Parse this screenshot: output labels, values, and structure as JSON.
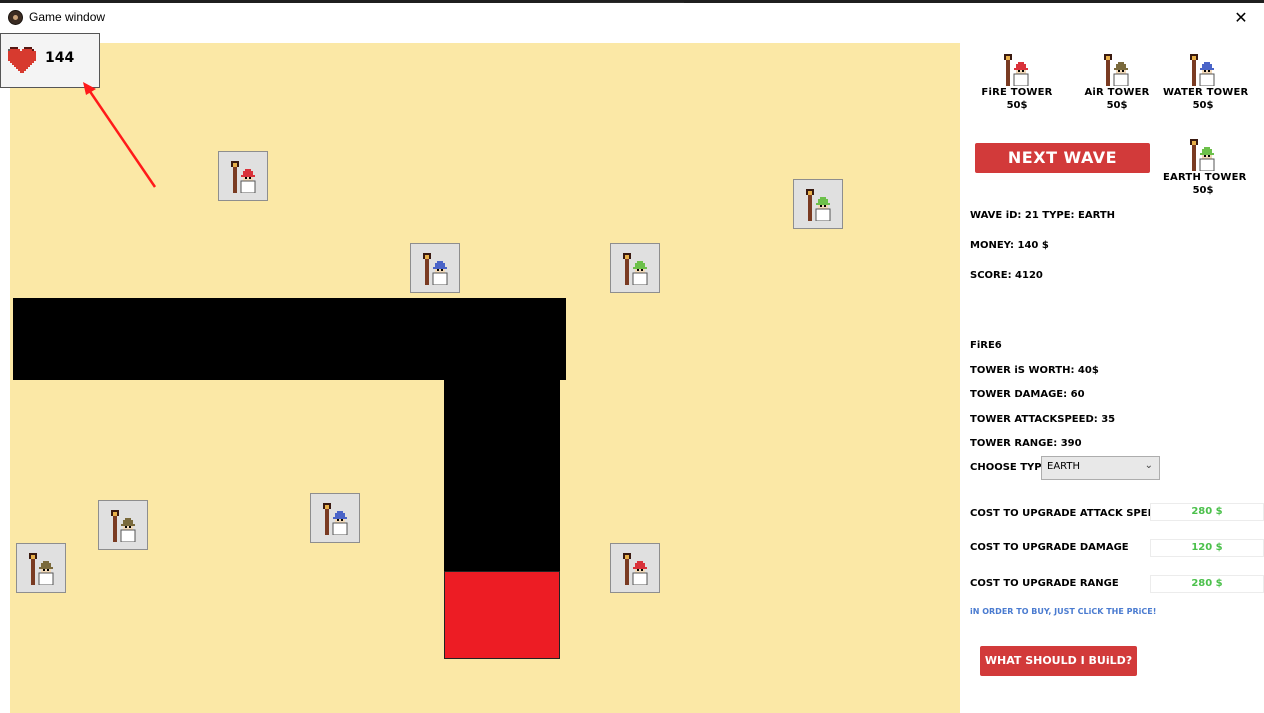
{
  "window": {
    "title": "Game window",
    "close_glyph": "✕"
  },
  "lives": {
    "value": "144",
    "icon": "heart-icon",
    "color": "#d73a2f"
  },
  "colors": {
    "map_background": "#fbe8a6",
    "path": "#000000",
    "base": "#ed1c24",
    "button": "#d23a3a",
    "upgrade_price": "#4bc04b",
    "hint": "#4a7bd0"
  },
  "towers_on_map": [
    {
      "type": "fire"
    },
    {
      "type": "earth"
    },
    {
      "type": "water"
    },
    {
      "type": "earth"
    },
    {
      "type": "air"
    },
    {
      "type": "water"
    },
    {
      "type": "air"
    },
    {
      "type": "fire"
    }
  ],
  "shop": {
    "items": [
      {
        "name": "FiRE TOWER",
        "price": "50$",
        "type": "fire"
      },
      {
        "name": "AiR TOWER",
        "price": "50$",
        "type": "air"
      },
      {
        "name": "WATER TOWER",
        "price": "50$",
        "type": "water"
      },
      {
        "name": "EARTH TOWER",
        "price": "50$",
        "type": "earth"
      }
    ],
    "next_wave_label": "NEXT WAVE"
  },
  "stats": {
    "wave": "WAVE iD: 21 TYPE: EARTH",
    "money": "MONEY: 140 $",
    "score": "SCORE: 4120"
  },
  "selected_tower": {
    "name": "FiRE6",
    "worth": "TOWER iS WORTH: 40$",
    "damage": "TOWER DAMAGE: 60",
    "attack_speed": "TOWER ATTACKSPEED: 35",
    "range": "TOWER RANGE: 390",
    "choose_type_label": "CHOOSE TYPE :",
    "type_value": "EARTH",
    "dropdown_glyph": "⌄"
  },
  "upgrades": {
    "attack_speed_label": "COST TO UPGRADE ATTACK SPEED",
    "attack_speed_price": "280 $",
    "damage_label": "COST TO UPGRADE DAMAGE",
    "damage_price": "120 $",
    "range_label": "COST TO UPGRADE RANGE",
    "range_price": "280 $",
    "buy_hint": "iN ORDER TO BUY, JUST CLiCK THE PRiCE!"
  },
  "advice_button_label": "WHAT SHOULD I BUiLD?"
}
